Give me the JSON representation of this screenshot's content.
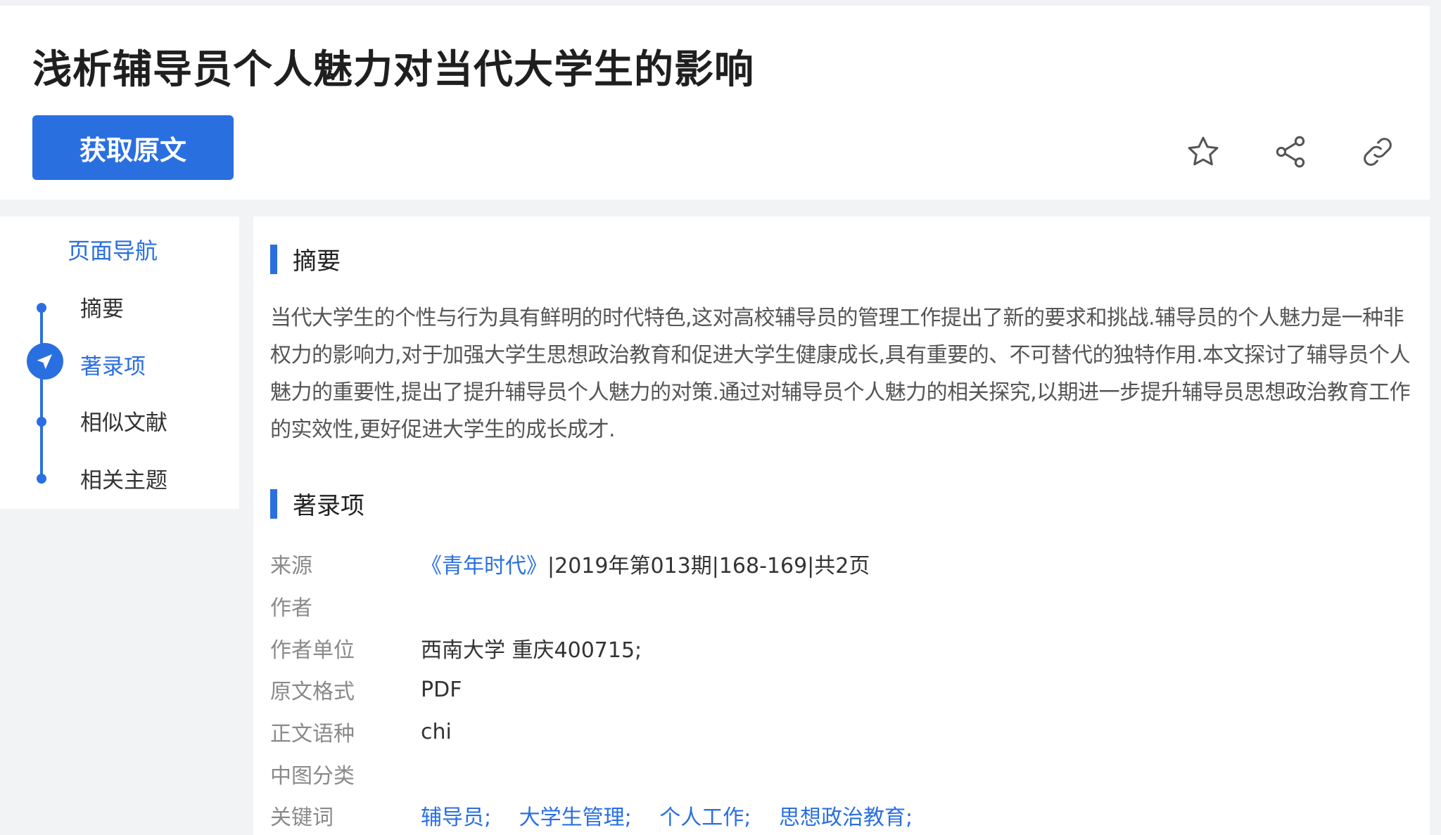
{
  "article": {
    "title": "浅析辅导员个人魅力对当代大学生的影响",
    "get_original_label": "获取原文"
  },
  "toolbar": {
    "icons": [
      "star-icon",
      "share-icon",
      "link-icon"
    ]
  },
  "nav": {
    "title": "页面导航",
    "items": [
      {
        "label": "摘要",
        "active": false
      },
      {
        "label": "著录项",
        "active": true
      },
      {
        "label": "相似文献",
        "active": false
      },
      {
        "label": "相关主题",
        "active": false
      }
    ]
  },
  "abstract": {
    "heading": "摘要",
    "text": "当代大学生的个性与行为具有鲜明的时代特色,这对高校辅导员的管理工作提出了新的要求和挑战.辅导员的个人魅力是一种非权力的影响力,对于加强大学生思想政治教育和促进大学生健康成长,具有重要的、不可替代的独特作用.本文探讨了辅导员个人魅力的重要性,提出了提升辅导员个人魅力的对策.通过对辅导员个人魅力的相关探究,以期进一步提升辅导员思想政治教育工作的实效性,更好促进大学生的成长成才."
  },
  "bibliography": {
    "heading": "著录项",
    "source_label": "来源",
    "source_journal": "《青年时代》",
    "source_detail": "|2019年第013期|168-169|共2页",
    "author_label": "作者",
    "author_value": "",
    "affiliation_label": "作者单位",
    "affiliation_value": "西南大学 重庆400715;",
    "format_label": "原文格式",
    "format_value": "PDF",
    "language_label": "正文语种",
    "language_value": "chi",
    "clc_label": "中图分类",
    "clc_value": "",
    "keywords_label": "关键词",
    "keywords": [
      "辅导员;",
      "大学生管理;",
      "个人工作;",
      "思想政治教育;"
    ]
  },
  "colors": {
    "accent": "#2a6fe0",
    "background": "#f2f3f5",
    "label_gray": "#8a8a8a"
  }
}
